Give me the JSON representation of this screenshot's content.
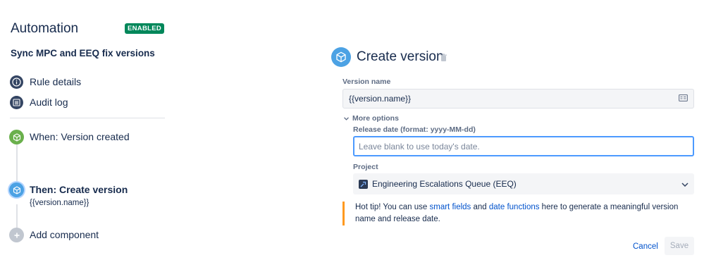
{
  "header": {
    "title": "Automation",
    "status_badge": "ENABLED"
  },
  "rule": {
    "name": "Sync MPC and EEQ fix versions"
  },
  "sidebar": {
    "items": [
      {
        "label": "Rule details",
        "icon": "info-icon"
      },
      {
        "label": "Audit log",
        "icon": "list-icon"
      }
    ]
  },
  "flow": {
    "trigger": {
      "label": "When: Version created",
      "icon": "cube-icon",
      "color": "#6ab04c"
    },
    "action": {
      "label": "Then: Create version",
      "sublabel": "{{version.name}}",
      "icon": "cube-icon",
      "color": "#4ca2e4"
    },
    "add": {
      "label": "Add component",
      "icon": "plus-icon"
    }
  },
  "panel": {
    "title": "Create version",
    "version_name_label": "Version name",
    "version_name_value": "{{version.name}}",
    "more_options_label": "More options",
    "release_date_label": "Release date (format: yyyy-MM-dd)",
    "release_date_placeholder": "Leave blank to use today's date.",
    "project_label": "Project",
    "project_value": "Engineering Escalations Queue (EEQ)",
    "tip": {
      "prefix": "Hot tip! You can use ",
      "link1": "smart fields",
      "middle": " and ",
      "link2": "date functions",
      "suffix": " here to generate a meaningful version name and release date."
    },
    "cancel_label": "Cancel",
    "save_label": "Save"
  },
  "colors": {
    "accent": "#0052cc",
    "enabled": "#00875a",
    "focus": "#4c9aff",
    "tip_border": "#ff991f"
  }
}
